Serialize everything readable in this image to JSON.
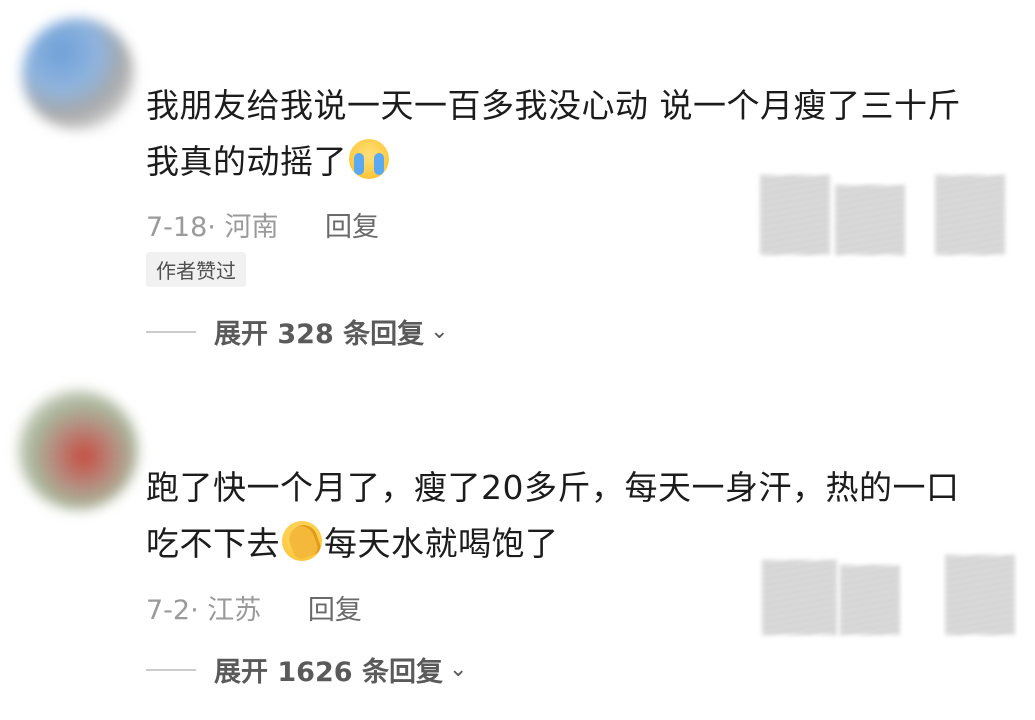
{
  "comments": [
    {
      "text_part1": "我朋友给我说一天一百多我没心动 说一个月瘦了三十斤我真的动摇了",
      "emoji": "crying-face-icon",
      "text_part2": "",
      "date": "7-18",
      "location": "河南",
      "reply_label": "回复",
      "badge": "作者赞过",
      "expand_label": "展开 328 条回复"
    },
    {
      "text_part1": "跑了快一个月了，瘦了20多斤，每天一身汗，热的一口吃不下去",
      "emoji": "facepalm-icon",
      "text_part2": "每天水就喝饱了",
      "date": "7-2",
      "location": "江苏",
      "reply_label": "回复",
      "expand_label": "展开 1626 条回复"
    }
  ]
}
